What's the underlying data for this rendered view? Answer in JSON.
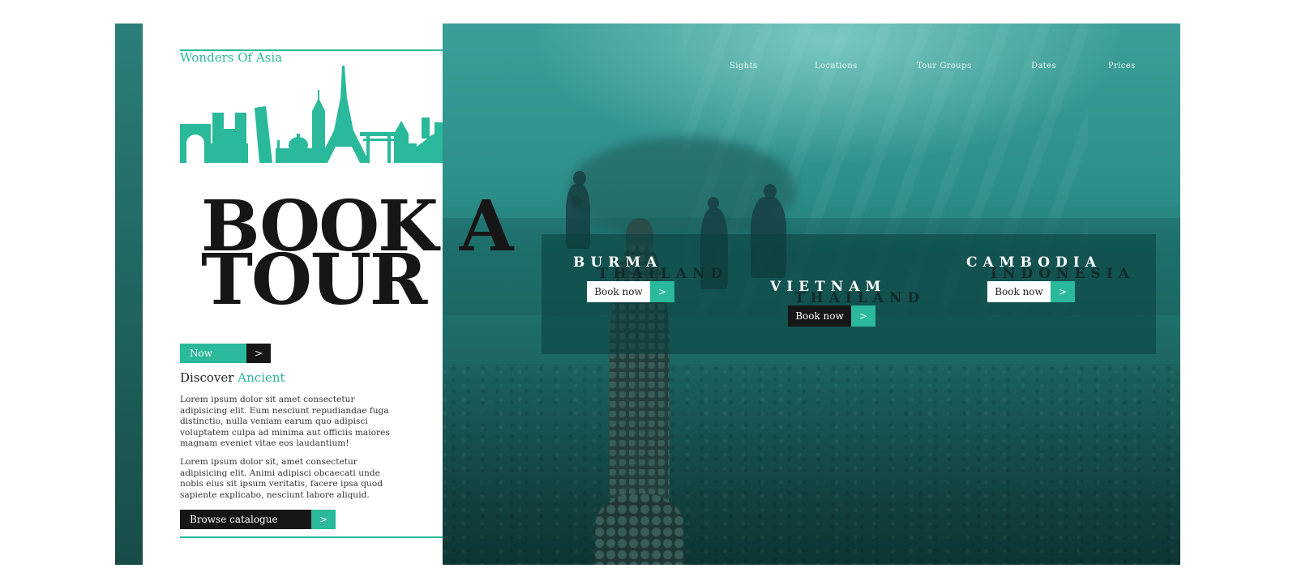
{
  "brand": {
    "name": "Wonders Of Asia"
  },
  "nav": {
    "items": [
      "Sights",
      "Locations",
      "Tour Groups",
      "Dates",
      "Prices"
    ]
  },
  "hero": {
    "headline_line1": "BOOK A",
    "headline_line2": "TOUR",
    "cta_label": "Now",
    "cta_arrow": ">"
  },
  "intro": {
    "heading_plain": "Discover",
    "heading_accent": "Ancient",
    "paragraph1": "Lorem ipsum dolor sit amet consectetur adipisicing elit. Eum nesciunt repudiandae fuga distinctio, nulla veniam earum quo adipisci voluptatem culpa ad minima aut officiis maiores magnam eveniet vitae eos laudantium!",
    "paragraph2": "Lorem ipsum dolor sit, amet consectetur adipisicing elit. Animi adipisci obcaecati unde nobis eius sit ipsum veritatis, facere ipsa quod sapiente explicabo, nesciunt labore aliquid.",
    "browse_label": "Browse catalogue",
    "browse_arrow": ">"
  },
  "destinations": [
    {
      "name": "BURMA",
      "sub": "THAILAND",
      "button": "Book now",
      "arrow": ">",
      "style": "light"
    },
    {
      "name": "VIETNAM",
      "sub": "THAILAND",
      "button": "Book now",
      "arrow": ">",
      "style": "dark"
    },
    {
      "name": "CAMBODIA",
      "sub": "INDONESIA",
      "button": "Book now",
      "arrow": ">",
      "style": "light"
    }
  ],
  "colors": {
    "accent": "#2ab99a",
    "dark": "#161616",
    "water": "#2e8f8a"
  },
  "icons": [
    "skyline-landmarks-icon"
  ]
}
